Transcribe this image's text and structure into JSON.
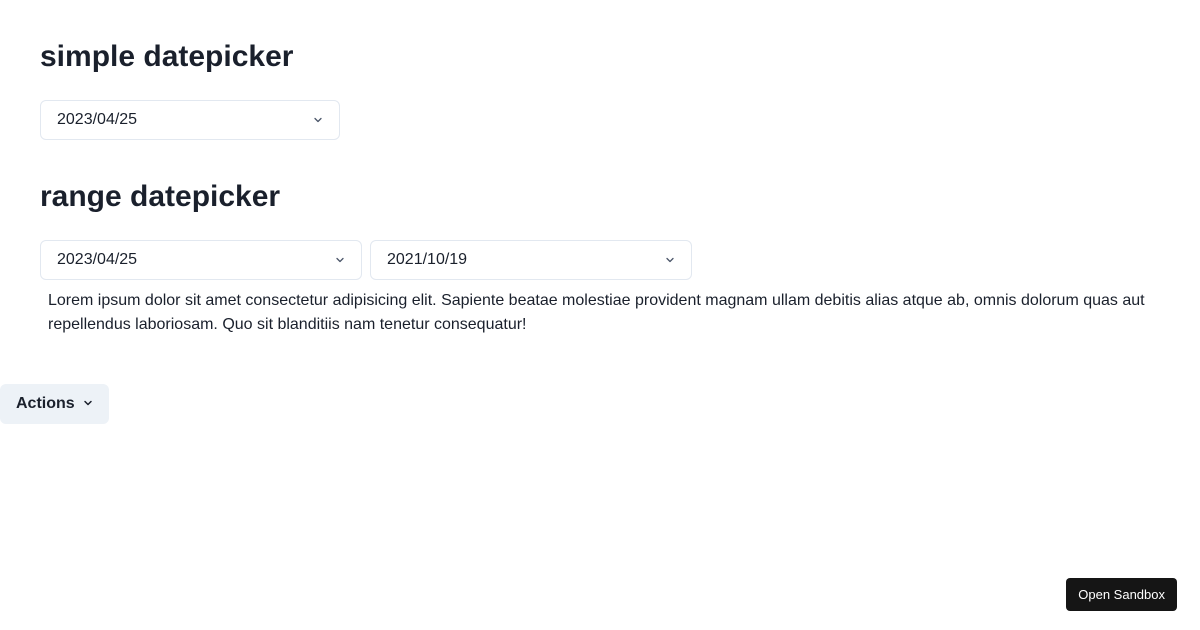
{
  "simple": {
    "heading": "simple datepicker",
    "value": "2023/04/25"
  },
  "range": {
    "heading": "range datepicker",
    "start_value": "2023/04/25",
    "end_value": "2021/10/19"
  },
  "body_text": "Lorem ipsum dolor sit amet consectetur adipisicing elit. Sapiente beatae molestiae provident magnam ullam debitis alias atque ab, omnis dolorum quas aut repellendus laboriosam. Quo sit blanditiis nam tenetur consequatur!",
  "actions": {
    "label": "Actions",
    "icon": "chevron-down-icon"
  },
  "sandbox": {
    "label": "Open Sandbox"
  },
  "colors": {
    "text": "#1a202c",
    "border": "#e2e8f0",
    "actions_bg": "#edf2f7",
    "sandbox_bg": "#151515"
  }
}
